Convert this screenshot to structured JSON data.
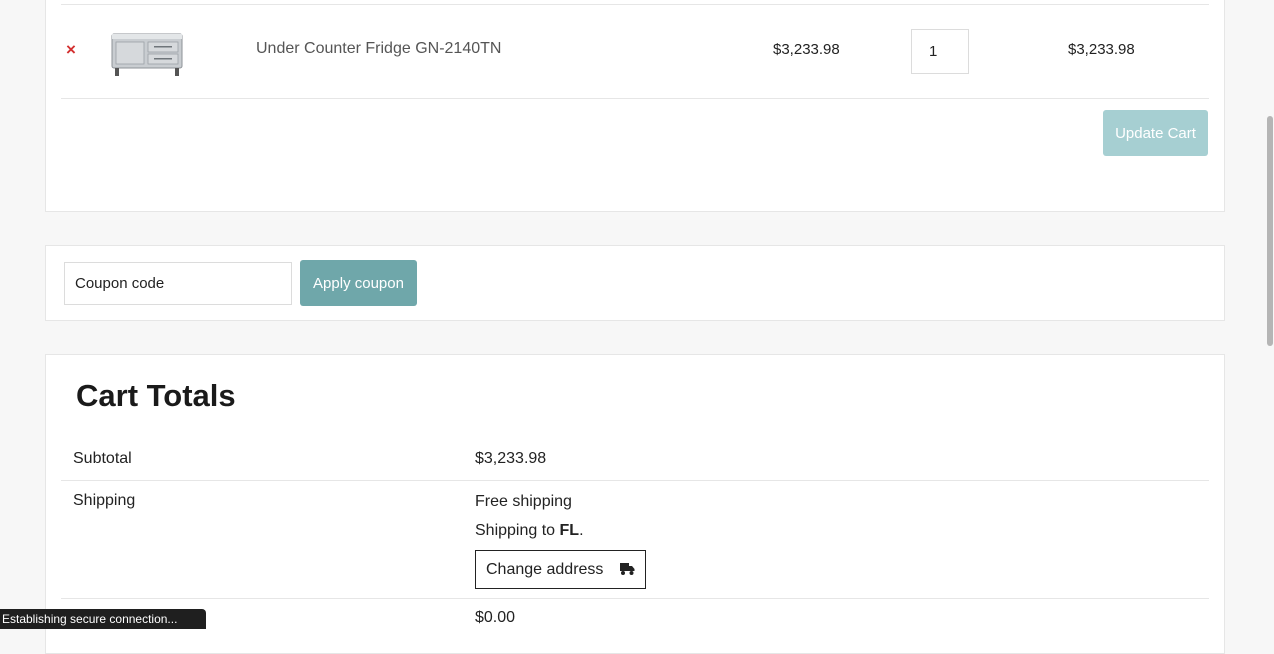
{
  "cart": {
    "item": {
      "remove_icon": "close-icon",
      "name": "Under Counter Fridge GN-2140TN",
      "price": "$3,233.98",
      "quantity": "1",
      "subtotal": "$3,233.98"
    },
    "update_label": "Update Cart"
  },
  "coupon": {
    "placeholder": "Coupon code",
    "apply_label": "Apply coupon"
  },
  "totals": {
    "title": "Cart Totals",
    "subtotal_label": "Subtotal",
    "subtotal_value": "$3,233.98",
    "shipping_label": "Shipping",
    "shipping_method": "Free shipping",
    "shipping_to_prefix": "Shipping to ",
    "shipping_to_state": "FL",
    "shipping_to_suffix": ".",
    "change_address_label": "Change address",
    "next_value": "$0.00"
  },
  "status": {
    "text": "Establishing secure connection..."
  },
  "colors": {
    "remove": "#d32f2f",
    "update_button": "#a6cfd2",
    "apply_button": "#6fa7aa"
  }
}
